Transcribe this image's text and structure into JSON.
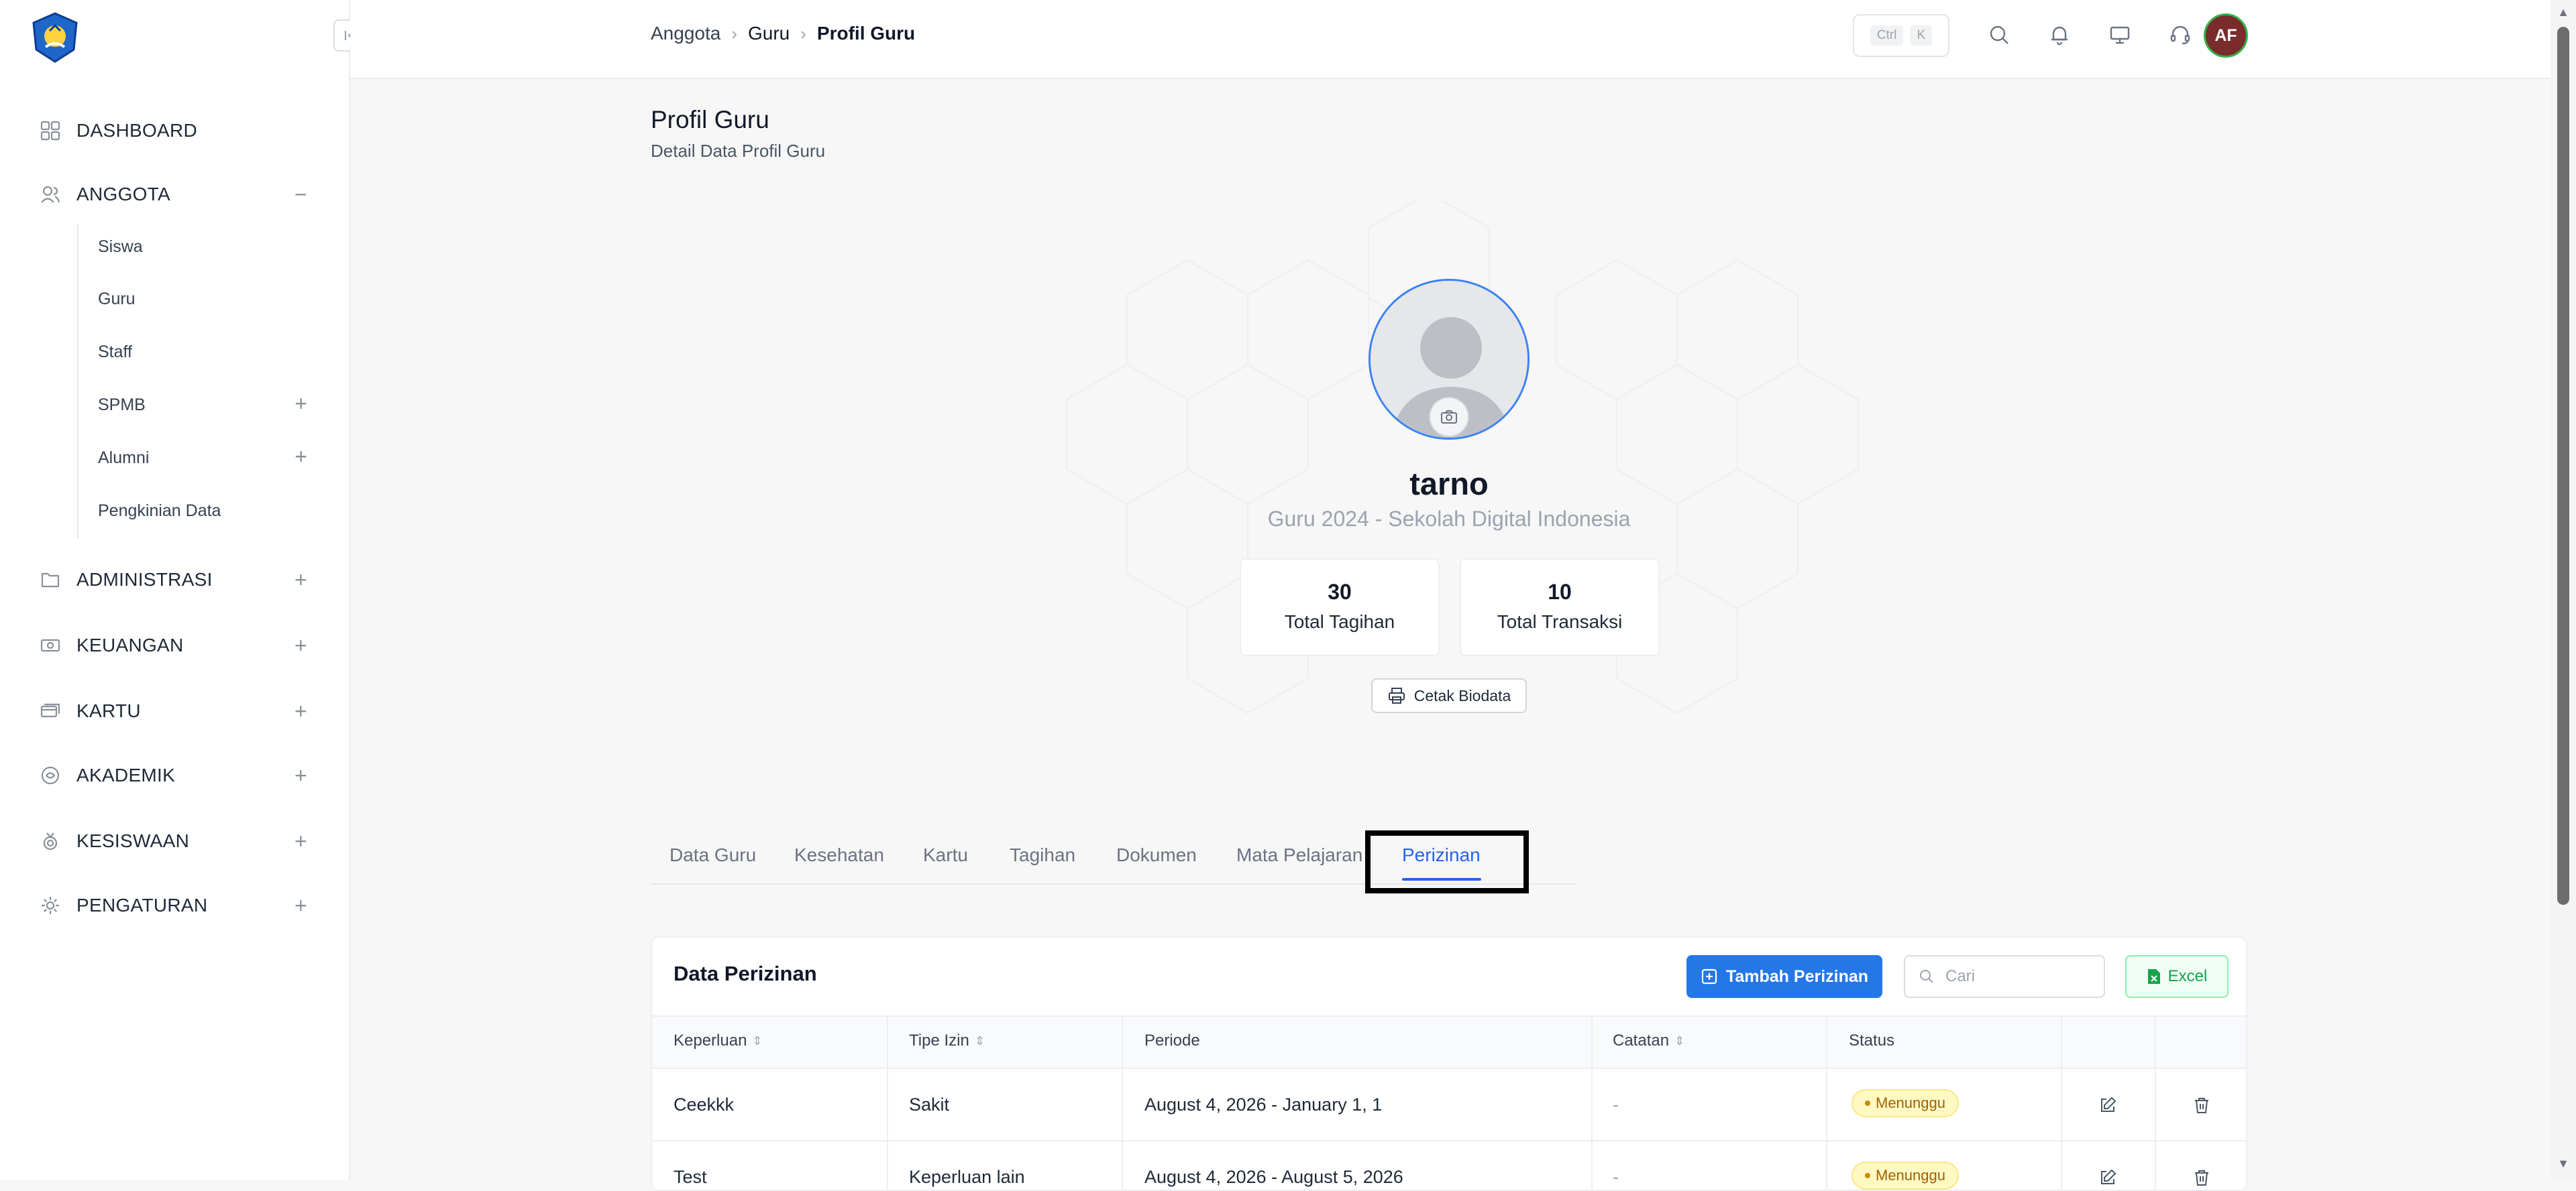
{
  "colors": {
    "accent": "#2563eb",
    "primary_button": "#2577e6",
    "excel": "#16a34a",
    "badge_warning": "#fef9c3",
    "avatar_bg": "#7a2b2b"
  },
  "sidebar": {
    "logo_icon": "tut-wuri-handayani-logo",
    "collapse_icon": "collapse-sidebar-icon",
    "items": [
      {
        "label": "DASHBOARD",
        "icon": "grid-icon",
        "toggle": ""
      },
      {
        "label": "ANGGOTA",
        "icon": "users-icon",
        "toggle": "−"
      },
      {
        "label": "ADMINISTRASI",
        "icon": "folder-icon",
        "toggle": "+"
      },
      {
        "label": "KEUANGAN",
        "icon": "money-icon",
        "toggle": "+"
      },
      {
        "label": "KARTU",
        "icon": "card-icon",
        "toggle": "+"
      },
      {
        "label": "AKADEMIK",
        "icon": "book-icon",
        "toggle": "+"
      },
      {
        "label": "KESISWAAN",
        "icon": "medal-icon",
        "toggle": "+"
      },
      {
        "label": "PENGATURAN",
        "icon": "gear-icon",
        "toggle": "+"
      }
    ],
    "anggota_sub": [
      {
        "label": "Siswa",
        "toggle": ""
      },
      {
        "label": "Guru",
        "toggle": ""
      },
      {
        "label": "Staff",
        "toggle": ""
      },
      {
        "label": "SPMB",
        "toggle": "+"
      },
      {
        "label": "Alumni",
        "toggle": "+"
      },
      {
        "label": "Pengkinian Data",
        "toggle": ""
      }
    ]
  },
  "topbar": {
    "breadcrumb": [
      "Anggota",
      "Guru",
      "Profil Guru"
    ],
    "shortcut_keys": [
      "Ctrl",
      "K"
    ],
    "icons": [
      "search-icon",
      "bell-icon",
      "monitor-icon",
      "headset-icon"
    ],
    "avatar_initials": "AF"
  },
  "page": {
    "title": "Profil Guru",
    "subtitle": "Detail Data Profil Guru"
  },
  "profile": {
    "name": "tarno",
    "meta": "Guru 2024 - Sekolah Digital Indonesia",
    "stats": [
      {
        "value": "30",
        "label": "Total Tagihan"
      },
      {
        "value": "10",
        "label": "Total Transaksi"
      }
    ],
    "print_label": "Cetak Biodata"
  },
  "tabs": [
    {
      "label": "Data Guru",
      "active": false
    },
    {
      "label": "Kesehatan",
      "active": false
    },
    {
      "label": "Kartu",
      "active": false
    },
    {
      "label": "Tagihan",
      "active": false
    },
    {
      "label": "Dokumen",
      "active": false
    },
    {
      "label": "Mata Pelajaran",
      "active": false
    },
    {
      "label": "Perizinan",
      "active": true
    }
  ],
  "table": {
    "title": "Data Perizinan",
    "add_label": "Tambah Perizinan",
    "search_placeholder": "Cari",
    "excel_label": "Excel",
    "columns": [
      {
        "label": "Keperluan",
        "sortable": true
      },
      {
        "label": "Tipe Izin",
        "sortable": true
      },
      {
        "label": "Periode",
        "sortable": false
      },
      {
        "label": "Catatan",
        "sortable": true
      },
      {
        "label": "Status",
        "sortable": false
      }
    ],
    "rows": [
      {
        "keperluan": "Ceekkk",
        "tipe": "Sakit",
        "periode": "August 4, 2026 - January 1, 1",
        "catatan": "-",
        "status": "Menunggu"
      },
      {
        "keperluan": "Test",
        "tipe": "Keperluan lain",
        "periode": "August 4, 2026 - August 5, 2026",
        "catatan": "-",
        "status": "Menunggu"
      }
    ]
  }
}
